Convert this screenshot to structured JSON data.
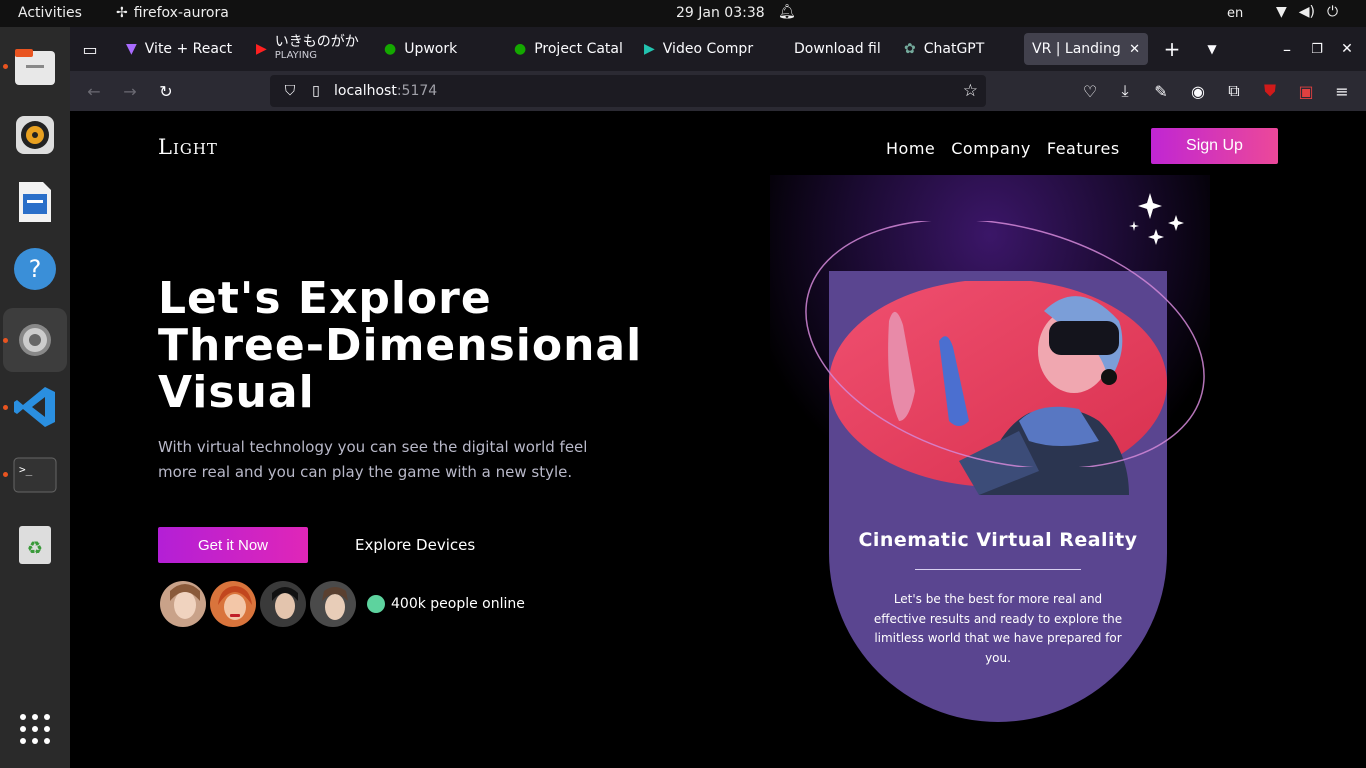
{
  "system": {
    "activities": "Activities",
    "app_name": "firefox-aurora",
    "clock": "29 Jan  03:38",
    "lang": "en"
  },
  "tabs": [
    {
      "label": "Vite + React"
    },
    {
      "label": "いきものがか",
      "sub": "PLAYING"
    },
    {
      "label": "Upwork"
    },
    {
      "label": "Project Catal"
    },
    {
      "label": "Video Compr"
    },
    {
      "label": "Download fil"
    },
    {
      "label": "ChatGPT"
    },
    {
      "label": "VR | Landing-p"
    }
  ],
  "url": {
    "host": "localhost",
    "port": ":5174"
  },
  "site": {
    "logo": "Light",
    "nav": [
      "Home",
      "Company",
      "Features"
    ],
    "signup": "Sign Up"
  },
  "hero": {
    "title_lines": [
      "Let's Explore",
      "Three-Dimensional",
      "Visual"
    ],
    "description": "With virtual technology you can see the digital world feel more real and you can play the game with a new style.",
    "cta": "Get it Now",
    "secondary": "Explore Devices",
    "online": "400k people online"
  },
  "card": {
    "title": "Cinematic Virtual Reality",
    "text": "Let's be the best for more real and effective results and ready to explore the limitless world that we have prepared for you."
  },
  "colors": {
    "accent_start": "#b31fd6",
    "accent_end": "#ec4899",
    "card": "#5a4590",
    "online_dot": "#5dd39e"
  }
}
